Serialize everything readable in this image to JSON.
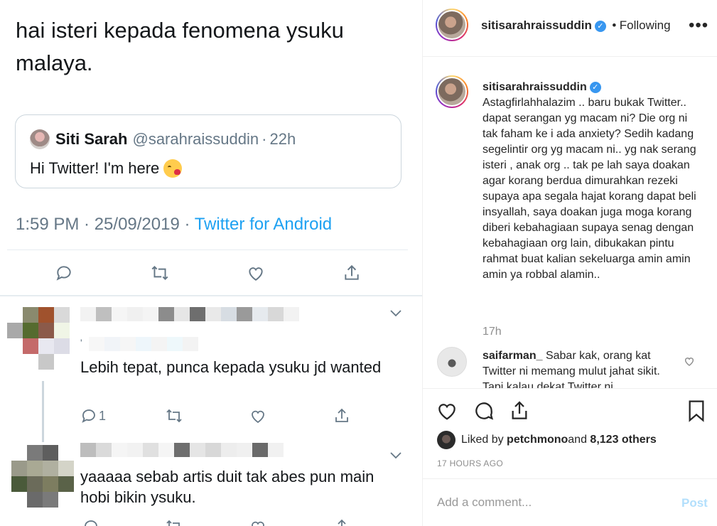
{
  "twitter": {
    "tweet_text": "hai isteri kepada fenomena ysuku malaya.",
    "quoted": {
      "name": "Siti Sarah",
      "handle": "@sarahraissuddin",
      "separator": "·",
      "time": "22h",
      "text": "Hi Twitter! I'm here"
    },
    "meta": {
      "time": "1:59 PM · 25/09/2019 · ",
      "source": "Twitter for Android"
    },
    "replies": [
      {
        "text": "Lebih tepat, punca kepada ysuku jd wanted",
        "reply_count": "1",
        "handle_fragment": "'"
      },
      {
        "text": "yaaaaa sebab artis duit tak abes pun main hobi bikin ysuku."
      }
    ]
  },
  "instagram": {
    "header": {
      "username": "sitisarahraissuddin",
      "dot": "•",
      "follow_state": "Following",
      "more": "•••"
    },
    "caption": {
      "username": "sitisarahraissuddin",
      "text": "Astagfirlahhalazim .. baru bukak Twitter.. dapat serangan yg macam ni? Die org ni tak faham ke i ada anxiety? Sedih kadang segelintir org yg macam ni.. yg nak serang isteri , anak org .. tak pe lah saya doakan agar korang berdua dimurahkan rezeki supaya apa segala hajat korang dapat beli insyallah, saya doakan juga moga korang diberi kebahagiaan supaya senag dengan kebahagiaan org lain, dibukakan pintu rahmat buat kalian sekeluarga amin amin amin ya robbal alamin..",
      "time": "17h"
    },
    "comment": {
      "username": "saifarman_",
      "text": "Sabar kak, orang kat Twitter ni memang mulut jahat sikit. Tapi kalau dekat Twitter ni"
    },
    "likes": {
      "prefix": "Liked by ",
      "user": "petchmono",
      "middle": " and ",
      "count": "8,123 others"
    },
    "time_ago": "17 HOURS AGO",
    "add_comment_placeholder": "Add a comment...",
    "post_label": "Post"
  },
  "colors": {
    "twitter_blue": "#1da1f2",
    "ig_verified": "#3897f0",
    "ig_post_disabled": "#b2dffc",
    "muted": "#657786"
  }
}
